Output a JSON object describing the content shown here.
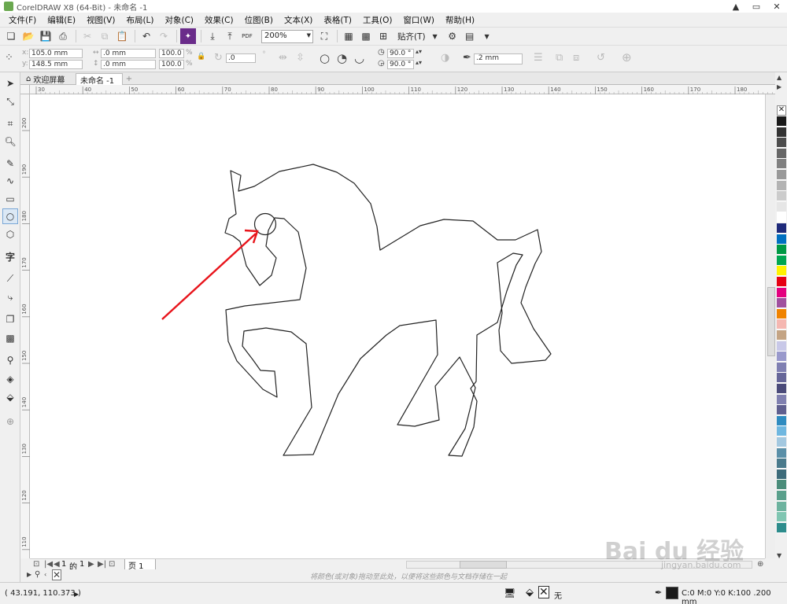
{
  "window": {
    "title": "CorelDRAW X8 (64-Bit) - 未命名 -1",
    "controls": [
      "▲",
      "▭",
      "✕"
    ]
  },
  "menu": [
    "文件(F)",
    "编辑(E)",
    "视图(V)",
    "布局(L)",
    "对象(C)",
    "效果(C)",
    "位图(B)",
    "文本(X)",
    "表格(T)",
    "工具(O)",
    "窗口(W)",
    "帮助(H)"
  ],
  "toolbar": {
    "zoom": "200%",
    "snap_label": "贴齐(T)",
    "pdf_label": "PDF"
  },
  "properties": {
    "x": "105.0 mm",
    "y": "148.5 mm",
    "width": ".0 mm",
    "height": ".0 mm",
    "scale_x": "100.0",
    "scale_y": "100.0",
    "percent": "%",
    "rotation": ".0",
    "start_angle": "90.0 °",
    "end_angle": "90.0 °",
    "outline_width": ".2 mm"
  },
  "tabs": {
    "welcome": "欢迎屏幕",
    "document": "未命名 -1",
    "add": "+"
  },
  "ruler": {
    "h_ticks": [
      "30",
      "40",
      "50",
      "60",
      "70",
      "80",
      "90",
      "100",
      "110",
      "120",
      "130",
      "140",
      "150",
      "160",
      "170",
      "180"
    ],
    "v_ticks": [
      "200",
      "190",
      "180",
      "170",
      "160",
      "150",
      "140",
      "130",
      "120",
      "110"
    ]
  },
  "pagebar": {
    "current": "1",
    "of": "的",
    "total": "1",
    "page_tab": "页 1"
  },
  "hint": "将颜色(或对象)拖动至此处，以便将这些颜色与文档存储在一起",
  "status": {
    "coords": "( 43.191, 110.373 )",
    "fill_none": "无",
    "color_spec": "C:0 M:0 Y:0 K:100  .200 mm"
  },
  "watermark": {
    "brand": "Bai du 经验",
    "url": "jingyan.baidu.com"
  },
  "palette": [
    "#1a1a1a",
    "#333333",
    "#4d4d4d",
    "#666666",
    "#808080",
    "#999999",
    "#b3b3b3",
    "#cccccc",
    "#e6e6e6",
    "#ffffff",
    "#1f2a7a",
    "#0070c0",
    "#009944",
    "#00a651",
    "#fff200",
    "#e60012",
    "#e4007f",
    "#a0509f",
    "#f08300",
    "#f5b7b1",
    "#c4a484",
    "#c8c8e8",
    "#9999cc",
    "#7f7fb2",
    "#666699",
    "#4b4b7a",
    "#8080b0",
    "#5f5f8f",
    "#2e8bc0",
    "#6fb7e0",
    "#a3c8e0",
    "#5a8fa8",
    "#4a7a8c",
    "#3d6b7a",
    "#4a8c7a",
    "#5aa08c",
    "#6db39f",
    "#80c6b2",
    "#2d8c8c"
  ],
  "colors": {
    "arrow": "#e8141b",
    "outline": "#222222"
  }
}
